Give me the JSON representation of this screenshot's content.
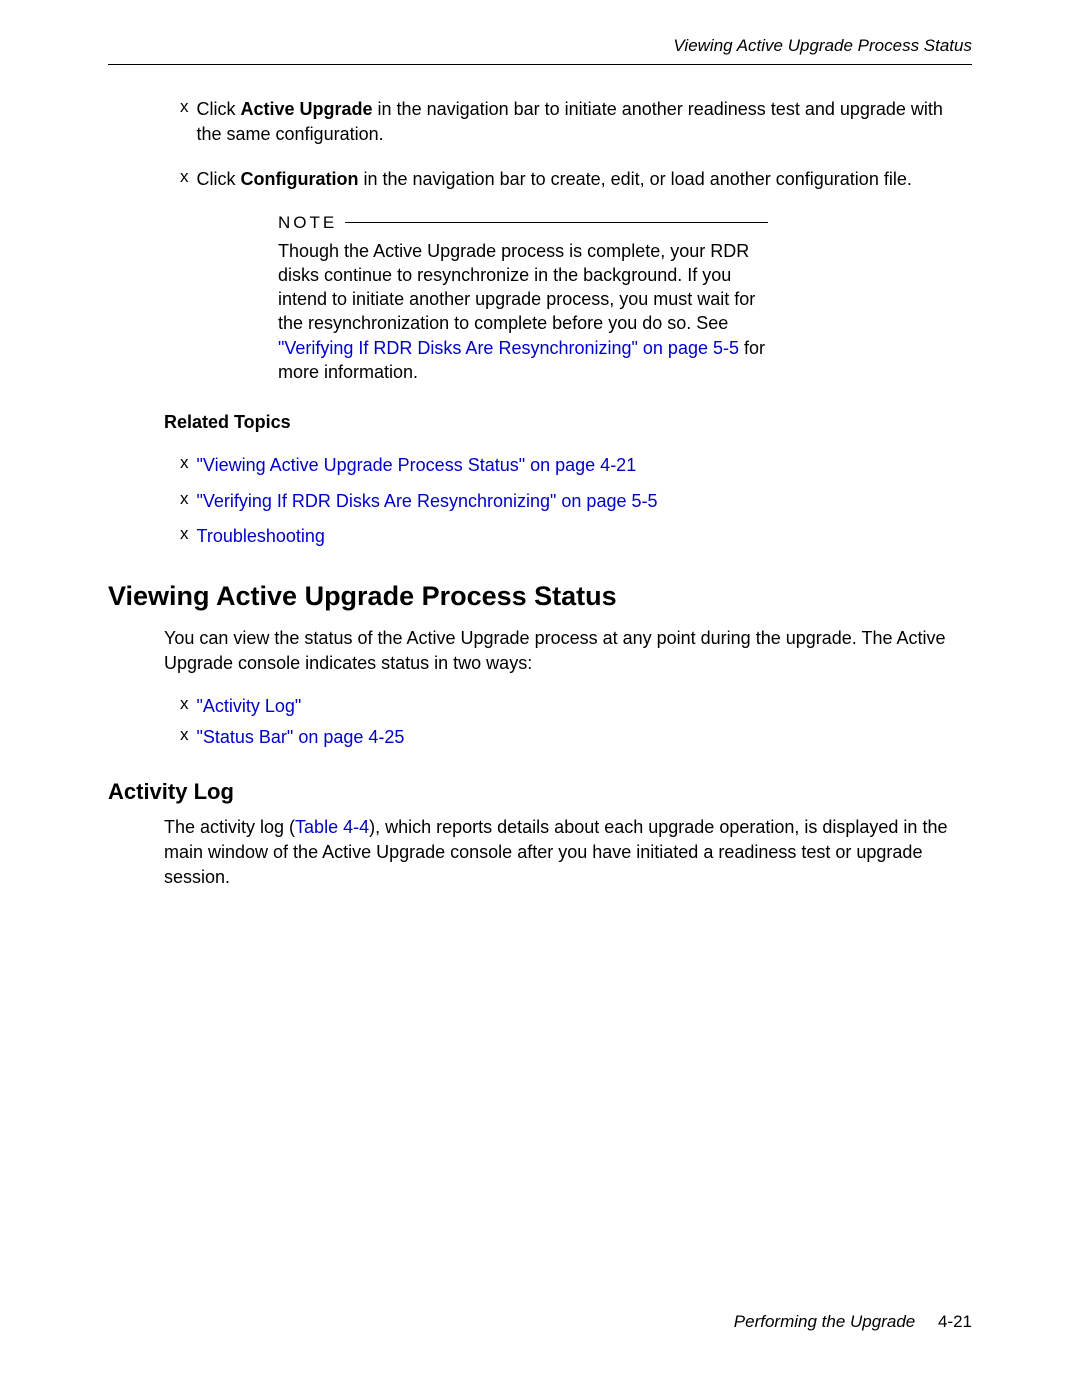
{
  "header": {
    "running_title": "Viewing Active Upgrade Process Status"
  },
  "intro_list": {
    "item1": {
      "bullet": "x",
      "pre": "Click ",
      "bold": "Active Upgrade",
      "post": " in the navigation bar to initiate another readiness test and upgrade with the same configuration."
    },
    "item2": {
      "bullet": "x",
      "pre": "Click ",
      "bold": "Configuration",
      "post": " in the navigation bar to create, edit, or load another configuration file."
    }
  },
  "note": {
    "label": "NOTE",
    "body_pre": "Though the Active Upgrade process is complete, your RDR disks continue to resynchronize in the background. If you intend to initiate another upgrade process, you must wait for the resynchronization to complete before you do so. See ",
    "link": "\"Verifying If RDR Disks Are Resynchronizing\" on page 5-5",
    "body_post": " for more information."
  },
  "related": {
    "heading": "Related Topics",
    "items": [
      {
        "bullet": "x",
        "text": "\"Viewing Active Upgrade Process Status\" on page 4-21"
      },
      {
        "bullet": "x",
        "text": "\"Verifying If RDR Disks Are Resynchronizing\" on page 5-5"
      },
      {
        "bullet": "x",
        "text": "Troubleshooting"
      }
    ]
  },
  "section": {
    "h1": "Viewing Active Upgrade Process Status",
    "para": "You can view the status of the Active Upgrade process at any point during the upgrade. The Active Upgrade console indicates status in two ways:",
    "links": [
      {
        "bullet": "x",
        "text": "\"Activity Log\""
      },
      {
        "bullet": "x",
        "text": "\"Status Bar\" on page 4-25"
      }
    ],
    "h2": "Activity Log",
    "para2_pre": "The activity log (",
    "para2_link": "Table 4-4",
    "para2_post": "), which reports details about each upgrade operation, is displayed in the main window of the Active Upgrade console after you have initiated a readiness test or upgrade session."
  },
  "footer": {
    "title": "Performing the Upgrade",
    "page": "4-21"
  }
}
